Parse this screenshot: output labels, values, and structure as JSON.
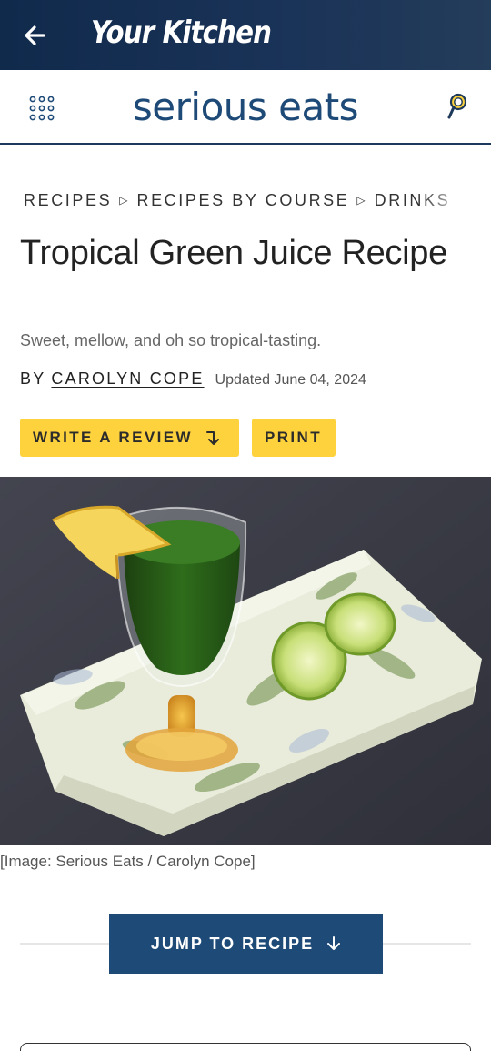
{
  "appbar": {
    "title": "Your Kitchen"
  },
  "site": {
    "logo": "serious eats"
  },
  "breadcrumb": {
    "items": [
      "RECIPES",
      "RECIPES BY COURSE",
      "DRINKS"
    ]
  },
  "article": {
    "title": "Tropical Green Juice Recipe",
    "subtitle": "Sweet, mellow, and oh so tropical-tasting.",
    "by": "BY",
    "author": "CAROLYN COPE",
    "updated": "Updated June 04, 2024",
    "write_review": "WRITE A REVIEW",
    "print": "PRINT",
    "image_caption": "[Image: Serious Eats / Carolyn Cope]",
    "jump_to_recipe": "JUMP TO RECIPE"
  },
  "colors": {
    "appbar": "#102a4c",
    "brand_blue": "#1e4a78",
    "button_yellow": "#fdd23c"
  },
  "icons": {
    "back": "arrow-left-icon",
    "menu": "grid-menu-icon",
    "search": "search-icon"
  }
}
